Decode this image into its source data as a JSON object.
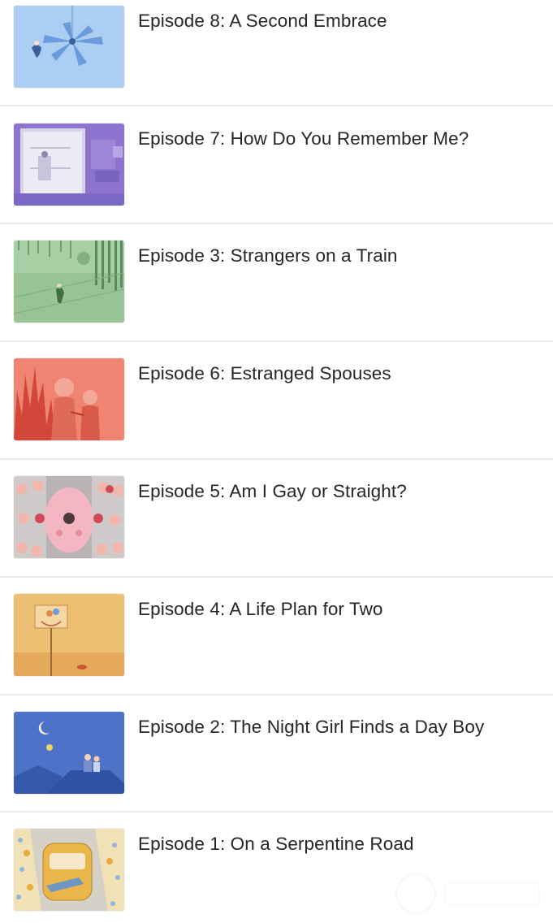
{
  "episodes": [
    {
      "title": "Episode 8: A Second Embrace",
      "thumb": "ceiling-fan-illustration",
      "color": "#a9cdf2"
    },
    {
      "title": "Episode 7: How Do You Remember Me?",
      "thumb": "purple-rooms-illustration",
      "color": "#8f78cf"
    },
    {
      "title": "Episode 3: Strangers on a Train",
      "thumb": "green-forest-illustration",
      "color": "#9fc89f"
    },
    {
      "title": "Episode 6: Estranged Spouses",
      "thumb": "red-flames-illustration",
      "color": "#ea7a66"
    },
    {
      "title": "Episode 5: Am I Gay or Straight?",
      "thumb": "faces-crowd-illustration",
      "color": "#c8c4c4"
    },
    {
      "title": "Episode 4: A Life Plan for Two",
      "thumb": "basketball-hoop-illustration",
      "color": "#e9b86d"
    },
    {
      "title": "Episode 2: The Night Girl Finds a Day Boy",
      "thumb": "night-rooftop-illustration",
      "color": "#4f74c9"
    },
    {
      "title": "Episode 1: On a Serpentine Road",
      "thumb": "yellow-car-illustration",
      "color": "#eed9a8"
    }
  ]
}
